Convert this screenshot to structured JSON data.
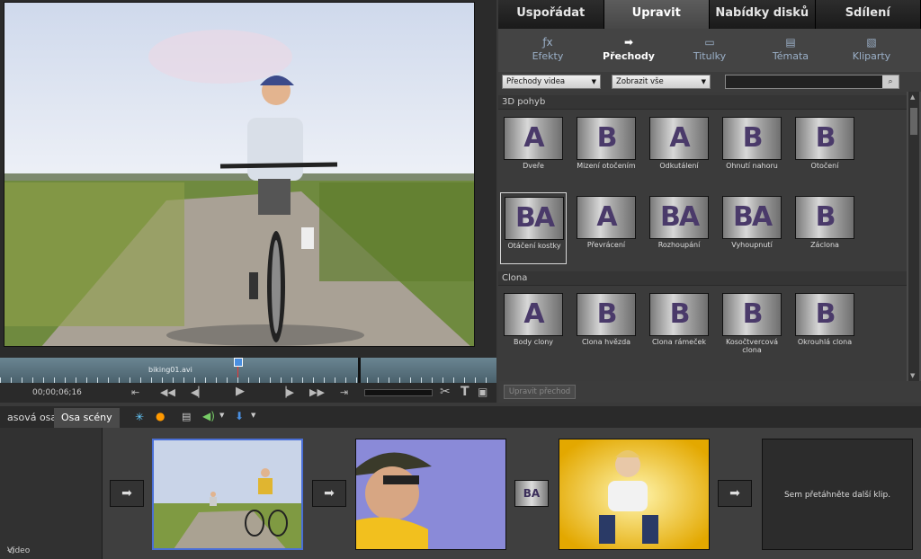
{
  "monitor": {
    "clip_name": "biking01.avi",
    "timecode": "00;00;06;16"
  },
  "tabs": [
    "Uspořádat",
    "Upravit",
    "Nabídky disků",
    "Sdílení"
  ],
  "subtabs": [
    {
      "label": "Efekty",
      "icon": "fx-icon"
    },
    {
      "label": "Přechody",
      "icon": "transition-icon"
    },
    {
      "label": "Titulky",
      "icon": "titles-icon"
    },
    {
      "label": "Témata",
      "icon": "themes-icon"
    },
    {
      "label": "Kliparty",
      "icon": "clipart-icon"
    }
  ],
  "filters": {
    "type": "Přechody videa",
    "show": "Zobrazit vše",
    "search_value": ""
  },
  "categories": [
    {
      "name": "3D pohyb",
      "items": [
        {
          "label": "Dveře",
          "glyph": "A"
        },
        {
          "label": "Mizení otočením",
          "glyph": "B"
        },
        {
          "label": "Odkutálení",
          "glyph": "A"
        },
        {
          "label": "Ohnutí nahoru",
          "glyph": "B"
        },
        {
          "label": "Otočení",
          "glyph": "B"
        },
        {
          "label": "Otáčení kostky",
          "glyph": "BA"
        },
        {
          "label": "Převrácení",
          "glyph": "A"
        },
        {
          "label": "Rozhoupání",
          "glyph": "BA"
        },
        {
          "label": "Vyhoupnutí",
          "glyph": "BA"
        },
        {
          "label": "Záclona",
          "glyph": "B"
        }
      ]
    },
    {
      "name": "Clona",
      "items": [
        {
          "label": "Body clony",
          "glyph": "A"
        },
        {
          "label": "Clona hvězda",
          "glyph": "B"
        },
        {
          "label": "Clona rámeček",
          "glyph": "B"
        },
        {
          "label": "Kosočtvercová clona",
          "glyph": "B"
        },
        {
          "label": "Okrouhlá clona",
          "glyph": "B"
        }
      ]
    }
  ],
  "edit_transition_button": "Upravit přechod",
  "timeline": {
    "tab_timeline": "asová osa",
    "tab_scenes": "Osa scény",
    "track_label": "Video",
    "drop_hint": "Sem přetáhněte další klip."
  },
  "colors": {
    "accent_selected": "#4a6fd6",
    "playhead": "#4a8fe0"
  }
}
